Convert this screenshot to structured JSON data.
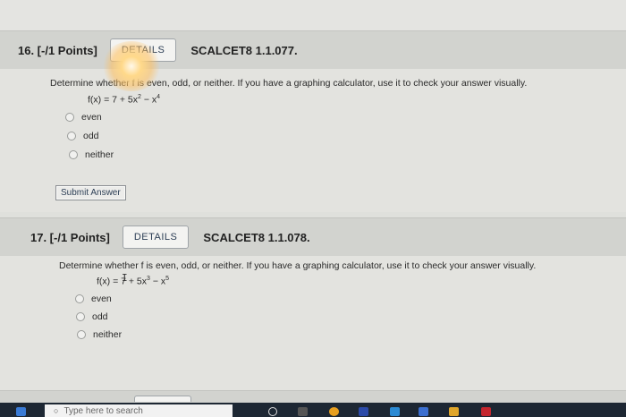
{
  "questions": [
    {
      "number": "16. [-/1 Points]",
      "details_label": "DETAILS",
      "code": "SCALCET8 1.1.077.",
      "prompt": "Determine whether f is even, odd, or neither. If you have a graphing calculator, use it to check your answer visually.",
      "formula_lhs": "f(x) = 7 + 5x",
      "exp1": "2",
      "formula_mid": " − x",
      "exp2": "4",
      "options": [
        "even",
        "odd",
        "neither"
      ],
      "submit_label": "Submit Answer"
    },
    {
      "number": "17. [-/1 Points]",
      "details_label": "DETAILS",
      "code": "SCALCET8 1.1.078.",
      "prompt": "Determine whether f is even, odd, or neither. If you have a graphing calculator, use it to check your answer visually.",
      "formula_lhs": "f(x) = 7 + 5x",
      "exp1": "3",
      "formula_mid": " − x",
      "exp2": "5",
      "options": [
        "even",
        "odd",
        "neither"
      ]
    }
  ],
  "taskbar": {
    "search_placeholder": "Type here to search"
  },
  "colors": {
    "header_bg": "#d2d3cf",
    "body_bg": "#e3e3df",
    "taskbar": "#1d2733"
  }
}
